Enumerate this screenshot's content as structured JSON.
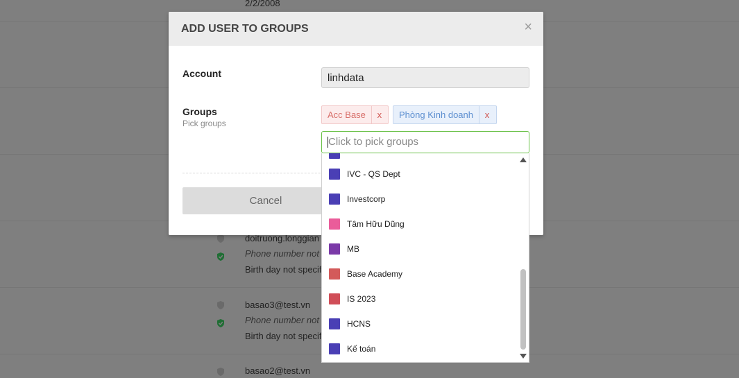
{
  "background": {
    "rows": [
      {
        "date": "2/2/2008"
      },
      {
        "username": "doitruong.longgian",
        "phone": "Phone number not s",
        "birthday": "Birth day not specifi"
      },
      {
        "username": "basao3@test.vn",
        "phone": "Phone number not s",
        "birthday": "Birth day not specifi"
      },
      {
        "username": "basao2@test.vn"
      }
    ]
  },
  "modal": {
    "title": "ADD USER TO GROUPS",
    "close_glyph": "×",
    "account_label": "Account",
    "account_value": "linhdata",
    "groups_label": "Groups",
    "groups_sublabel": "Pick groups",
    "selected_tags": [
      {
        "label": "Acc Base",
        "remove": "x",
        "color": "#d86f6a"
      },
      {
        "label": "Phòng Kinh doanh",
        "remove": "x",
        "color": "#5d8fd0"
      }
    ],
    "pick_placeholder": "Click to pick groups",
    "cancel_label": "Cancel"
  },
  "dropdown": {
    "options": [
      {
        "label": "IVC - QS Dept",
        "color": "#4a3fb5"
      },
      {
        "label": "Investcorp",
        "color": "#4a3fb5"
      },
      {
        "label": "Tâm Hữu Dũng",
        "color": "#ea5c9a"
      },
      {
        "label": "MB",
        "color": "#7b3aa8"
      },
      {
        "label": "Base Academy",
        "color": "#d35a5a"
      },
      {
        "label": "IS 2023",
        "color": "#d04e58"
      },
      {
        "label": "HCNS",
        "color": "#4a3fb5"
      },
      {
        "label": "Kế toán",
        "color": "#4a3fb5"
      }
    ]
  },
  "colors": {
    "accent_green": "#6cc24a",
    "shield_green": "#2e9e4a"
  }
}
